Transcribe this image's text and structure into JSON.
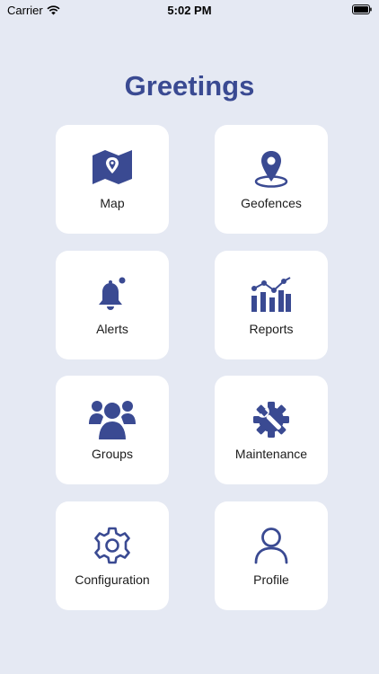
{
  "status_bar": {
    "carrier": "Carrier",
    "time": "5:02 PM"
  },
  "title": "Greetings",
  "tiles": [
    {
      "label": "Map",
      "icon": "map-icon"
    },
    {
      "label": "Geofences",
      "icon": "location-pin-icon"
    },
    {
      "label": "Alerts",
      "icon": "bell-icon"
    },
    {
      "label": "Reports",
      "icon": "bar-chart-icon"
    },
    {
      "label": "Groups",
      "icon": "users-icon"
    },
    {
      "label": "Maintenance",
      "icon": "gear-wrench-icon"
    },
    {
      "label": "Configuration",
      "icon": "settings-gear-icon"
    },
    {
      "label": "Profile",
      "icon": "user-icon"
    }
  ],
  "colors": {
    "accent": "#3a4a92",
    "background": "#e5e9f3",
    "tile": "#ffffff"
  }
}
